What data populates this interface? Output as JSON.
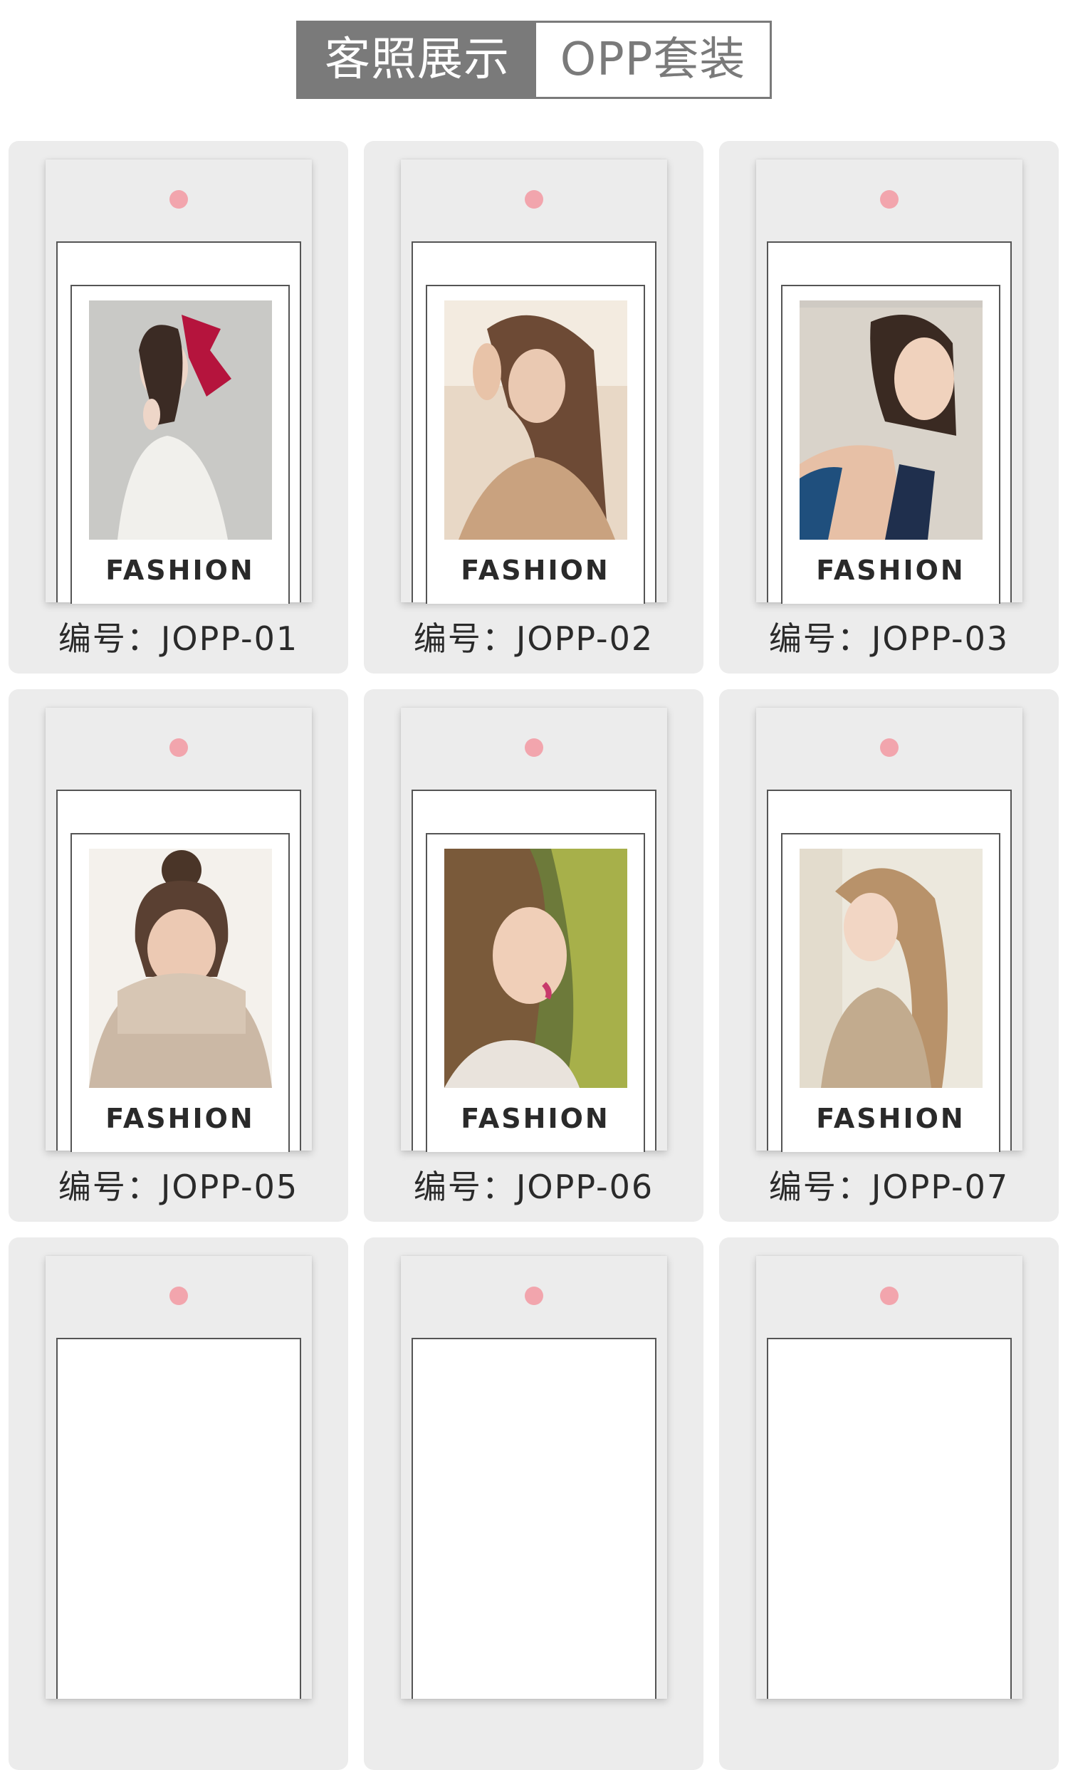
{
  "tabs": [
    {
      "label": "客照展示",
      "active": true
    },
    {
      "label": "OPP套装",
      "active": false
    }
  ],
  "colors": {
    "tab_active_bg": "#7a7a7a",
    "card_bg": "#ececec",
    "hang_hole": "#f2a5ad"
  },
  "cards": [
    {
      "brand": "FASHION",
      "code": "编号：JOPP-01"
    },
    {
      "brand": "FASHION",
      "code": "编号：JOPP-02"
    },
    {
      "brand": "FASHION",
      "code": "编号：JOPP-03"
    },
    {
      "brand": "FASHION",
      "code": "编号：JOPP-05"
    },
    {
      "brand": "FASHION",
      "code": "编号：JOPP-06"
    },
    {
      "brand": "FASHION",
      "code": "编号：JOPP-07"
    },
    {
      "brand": "",
      "code": ""
    },
    {
      "brand": "",
      "code": ""
    },
    {
      "brand": "",
      "code": ""
    }
  ]
}
